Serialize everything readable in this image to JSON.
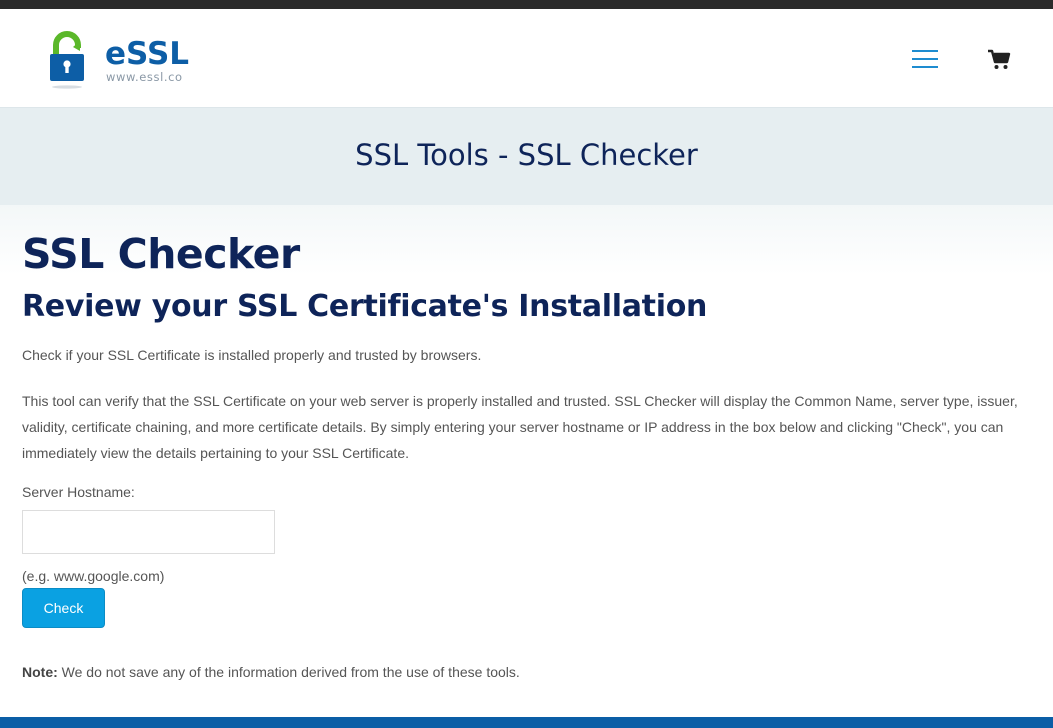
{
  "header": {
    "logo_text": "eSSL",
    "logo_url": "www.essl.co",
    "menu_icon": "hamburger-menu-icon",
    "cart_icon": "shopping-cart-icon"
  },
  "banner": {
    "title": "SSL Tools - SSL Checker"
  },
  "main": {
    "heading": "SSL Checker",
    "subheading": "Review your SSL Certificate's Installation",
    "intro": "Check if your SSL Certificate is installed properly and trusted by browsers.",
    "description": "This tool can verify that the SSL Certificate on your web server is properly installed and trusted. SSL Checker will display the Common Name, server type, issuer, validity, certificate chaining, and more certificate details. By simply entering your server hostname or IP address in the box below and clicking \"Check\", you can immediately view the details pertaining to your SSL Certificate.",
    "hostname_label": "Server Hostname:",
    "hostname_value": "",
    "hostname_hint": "(e.g. www.google.com)",
    "check_button": "Check",
    "note_label": "Note:",
    "note_text": " We do not save any of the information derived from the use of these tools."
  },
  "colors": {
    "brand_blue": "#0d5ea6",
    "logo_green": "#5bb82a",
    "heading_navy": "#0e2459",
    "button_blue": "#0aa1e2",
    "banner_bg": "#e6eef1",
    "footer_blue": "#0b5ea6"
  }
}
